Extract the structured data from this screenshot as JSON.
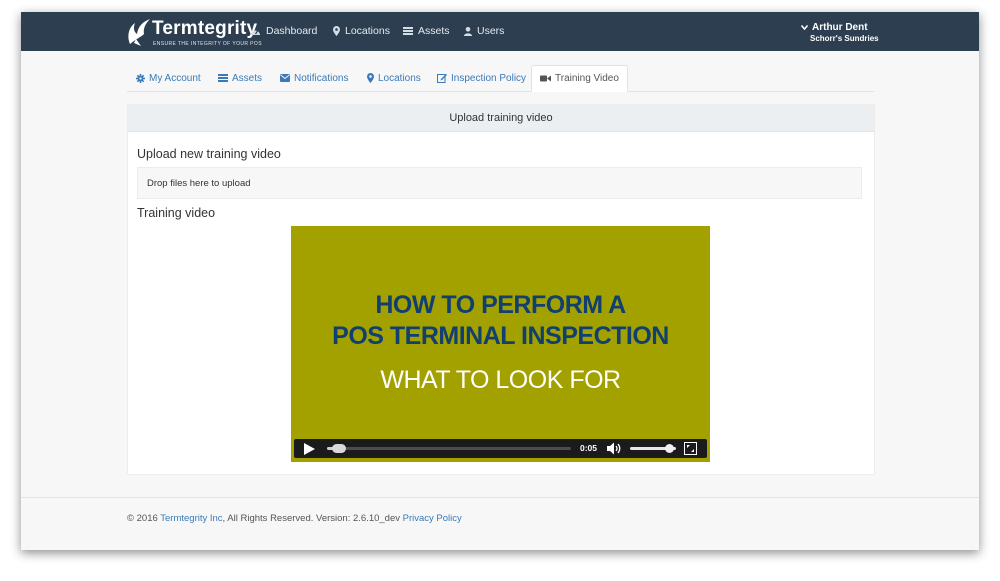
{
  "navbar": {
    "brand": "Termtegrity",
    "tagline": "ENSURE THE INTEGRITY OF YOUR POS",
    "items": [
      {
        "label": "Dashboard",
        "icon": "dashboard-icon"
      },
      {
        "label": "Locations",
        "icon": "map-marker-icon"
      },
      {
        "label": "Assets",
        "icon": "list-icon"
      },
      {
        "label": "Users",
        "icon": "user-icon"
      }
    ],
    "user": {
      "name": "Arthur Dent",
      "org": "Schorr's Sundries"
    }
  },
  "tabs": [
    {
      "label": "My Account",
      "icon": "gear-icon"
    },
    {
      "label": "Assets",
      "icon": "list-icon"
    },
    {
      "label": "Notifications",
      "icon": "envelope-icon"
    },
    {
      "label": "Locations",
      "icon": "map-marker-icon"
    },
    {
      "label": "Inspection Policy",
      "icon": "edit-icon"
    },
    {
      "label": "Training Video",
      "icon": "video-camera-icon",
      "active": true
    }
  ],
  "panel": {
    "heading": "Upload training video",
    "upload_title": "Upload new training video",
    "dropzone_text": "Drop files here to upload",
    "video_title": "Training video"
  },
  "video": {
    "line1": "HOW TO PERFORM A",
    "line2": "POS TERMINAL INSPECTION",
    "line3": "WHAT TO LOOK FOR",
    "time": "0:05",
    "progress": 0.03,
    "volume": 0.85,
    "colors": {
      "background": "#a3a100",
      "headline": "#113f70",
      "subline": "#ffffff"
    }
  },
  "footer": {
    "prefix": "© 2016 ",
    "company_link": "Termtegrity Inc",
    "middle": ", All Rights Reserved. Version: 2.6.10_dev ",
    "policy_link": "Privacy Policy"
  }
}
